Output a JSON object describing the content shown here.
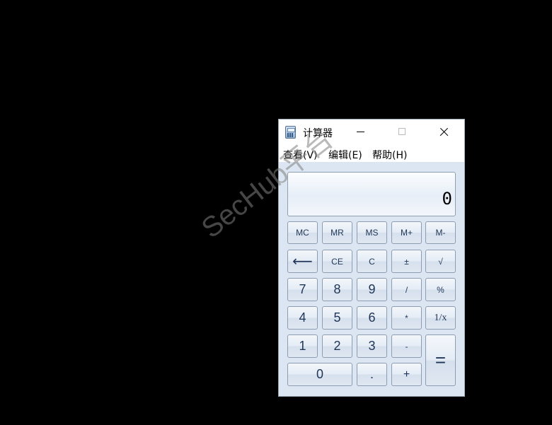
{
  "window": {
    "title": "计算器",
    "icon": "calculator-icon"
  },
  "menu": {
    "view": "查看(V)",
    "edit": "编辑(E)",
    "help": "帮助(H)"
  },
  "display": {
    "value": "0"
  },
  "keys": {
    "mc": "MC",
    "mr": "MR",
    "ms": "MS",
    "mplus": "M+",
    "mminus": "M-",
    "back": "⟵",
    "ce": "CE",
    "c": "C",
    "plusminus": "±",
    "sqrt": "√",
    "seven": "7",
    "eight": "8",
    "nine": "9",
    "divide": "/",
    "percent": "%",
    "four": "4",
    "five": "5",
    "six": "6",
    "multiply": "*",
    "reciprocal": "1/x",
    "one": "1",
    "two": "2",
    "three": "3",
    "minus": "-",
    "equals": "=",
    "zero": "0",
    "dot": ".",
    "plus": "+"
  },
  "watermark": "SecHub平台",
  "colors": {
    "background": "#000000",
    "window_body": "#dce6f2",
    "key_text": "#1f3556"
  }
}
